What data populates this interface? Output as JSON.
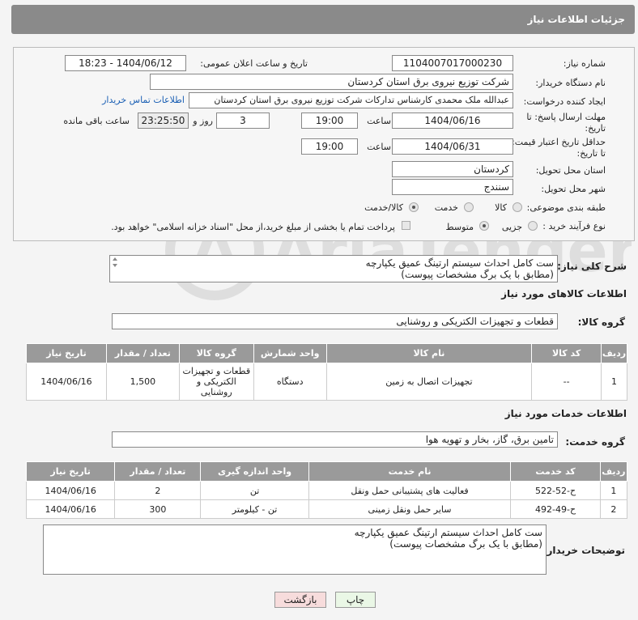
{
  "header": {
    "title": "جزئیات اطلاعات نیاز"
  },
  "form": {
    "need_number_label": "شماره نیاز:",
    "need_number": "1104007017000230",
    "announce_label": "تاریخ و ساعت اعلان عمومی:",
    "announce_value": "1404/06/12 - 18:23",
    "buyer_org_label": "نام دستگاه خریدار:",
    "buyer_org": "شرکت توزیع نیروی برق استان کردستان",
    "creator_label": "ایجاد کننده درخواست:",
    "creator": "عبدالله ملک محمدی کارشناس تدارکات شرکت توزیع نیروی برق استان کردستان",
    "contact_link": "اطلاعات تماس خریدار",
    "deadline_label_1": "مهلت ارسال پاسخ: تا",
    "deadline_label_2": "تاریخ:",
    "deadline_date": "1404/06/16",
    "time_label": "ساعت",
    "deadline_time": "19:00",
    "days_value": "3",
    "days_label": "روز و",
    "remaining_value": "23:25:50",
    "remaining_label": "ساعت باقی مانده",
    "validity_label_1": "حداقل تاریخ اعتبار قیمت:",
    "validity_label_2": "تا تاریخ:",
    "validity_date": "1404/06/31",
    "validity_time": "19:00",
    "province_label": "استان محل تحویل:",
    "province": "کردستان",
    "city_label": "شهر محل تحویل:",
    "city": "سنندج",
    "category_label": "طبقه بندی موضوعی:",
    "category_options": [
      "کالا",
      "خدمت",
      "کالا/خدمت"
    ],
    "category_selected": "کالا/خدمت",
    "process_label": "نوع فرآیند خرید :",
    "process_options": [
      "جزیی",
      "متوسط"
    ],
    "process_selected": "متوسط",
    "payment_note": "پرداخت تمام یا بخشی از مبلغ خرید،از محل \"اسناد خزانه اسلامی\" خواهد بود."
  },
  "general_desc": {
    "label": "شرح کلی نیاز:",
    "line1": "ست کامل احداث سیستم ارتینگ عمیق یکپارچه",
    "line2": "(مطابق با یک برگ مشخصات پیوست)"
  },
  "goods": {
    "section_title": "اطلاعات کالاهای مورد نیاز",
    "group_label": "گروه کالا:",
    "group_value": "قطعات و تجهیزات الکتریکی و روشنایی",
    "headers": [
      "ردیف",
      "کد کالا",
      "نام کالا",
      "واحد شمارش",
      "گروه کالا",
      "تعداد / مقدار",
      "تاریخ نیاز"
    ],
    "rows": [
      {
        "row": "1",
        "code": "--",
        "name": "تجهیزات اتصال به زمین",
        "unit": "دستگاه",
        "group_l1": "قطعات و تجهیزات",
        "group_l2": "الکتریکی و",
        "group_l3": "روشنایی",
        "qty": "1,500",
        "date": "1404/06/16"
      }
    ]
  },
  "services": {
    "section_title": "اطلاعات خدمات مورد نیاز",
    "group_label": "گروه خدمت:",
    "group_value": "تامین برق، گاز، بخار و تهویه هوا",
    "headers": [
      "ردیف",
      "کد خدمت",
      "نام خدمت",
      "واحد اندازه گیری",
      "تعداد / مقدار",
      "تاریخ نیاز"
    ],
    "rows": [
      {
        "row": "1",
        "code": "ح-52-522",
        "name": "فعالیت های پشتیبانی حمل ونقل",
        "unit": "تن",
        "qty": "2",
        "date": "1404/06/16"
      },
      {
        "row": "2",
        "code": "ح-49-492",
        "name": "سایر حمل ونقل زمینی",
        "unit": "تن - کیلومتر",
        "qty": "300",
        "date": "1404/06/16"
      }
    ]
  },
  "buyer_notes": {
    "label": "توضیحات خریدار:",
    "line1": "ست کامل احداث سیستم ارتینگ عمیق یکپارچه",
    "line2": "(مطابق با یک برگ مشخصات پیوست)"
  },
  "buttons": {
    "print": "چاپ",
    "back": "بازگشت"
  },
  "watermark": {
    "text": "AriaTender.neT"
  },
  "colors": {
    "header_bg": "#8a8a8a",
    "table_header_bg": "#9a9a9a",
    "link": "#1a5fb4",
    "back_button": "#f7dcdc",
    "print_button": "#eaf7e6"
  }
}
